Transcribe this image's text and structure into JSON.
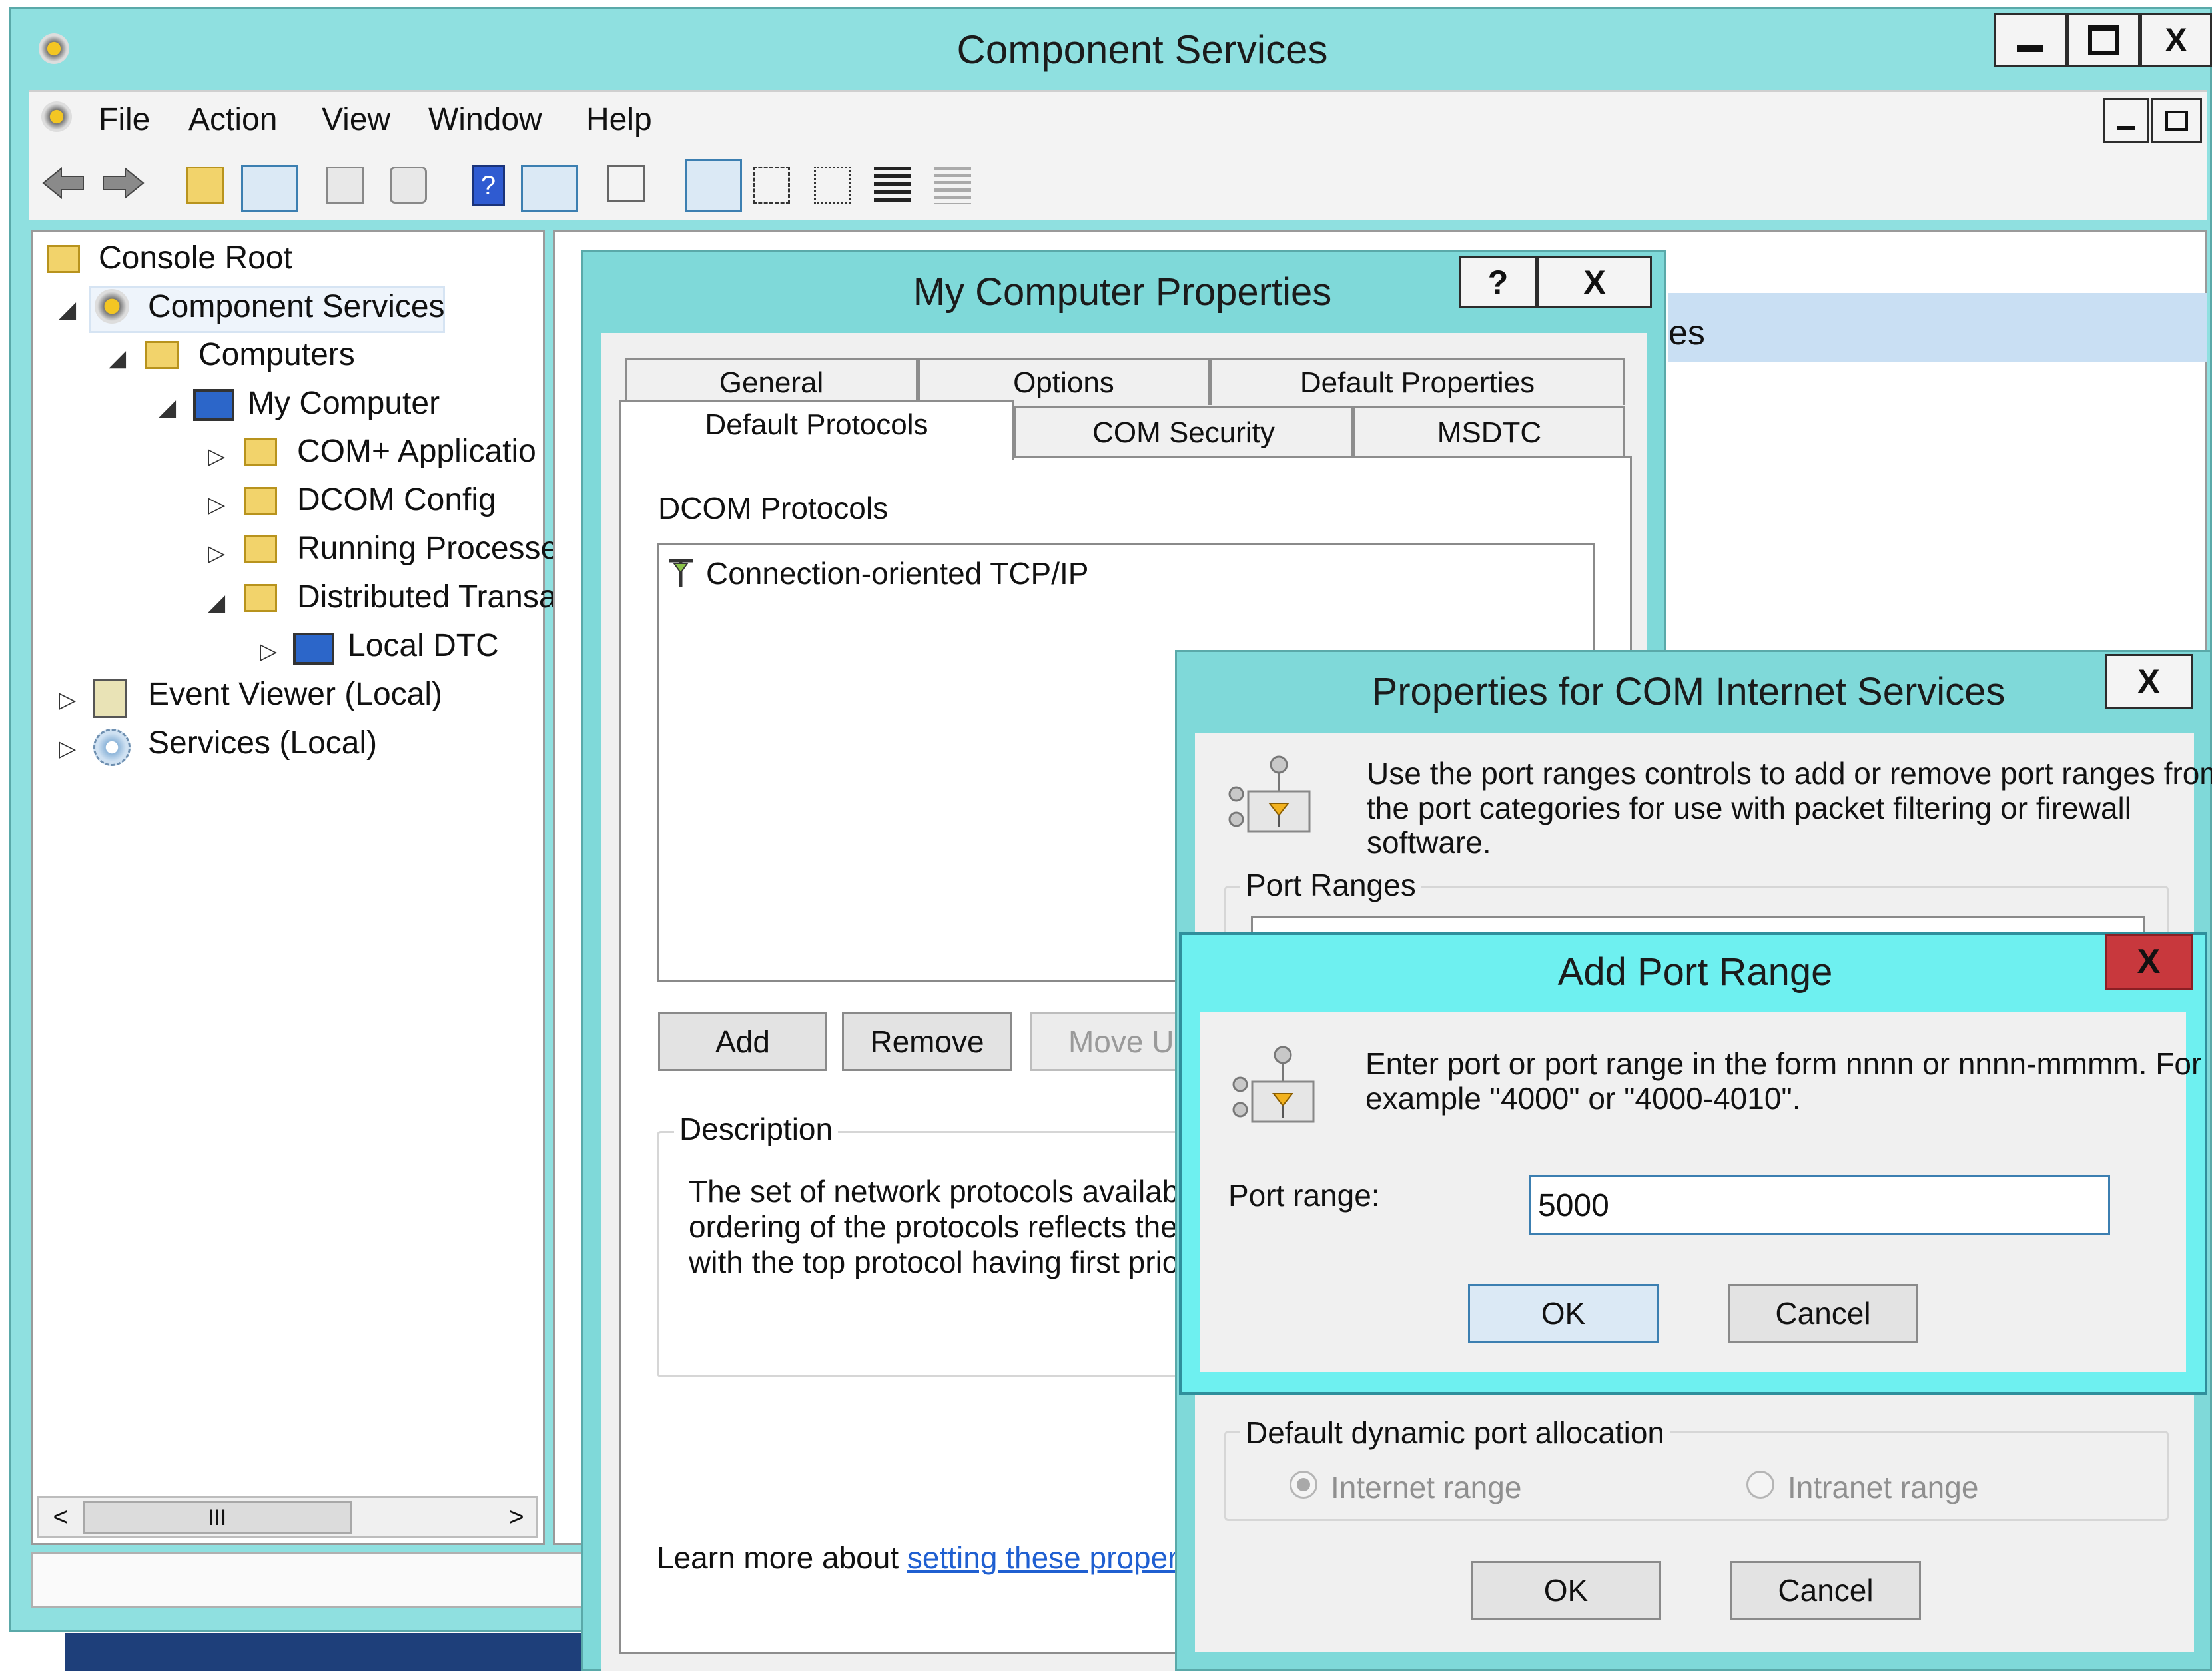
{
  "main_window": {
    "title": "Component Services",
    "menu": [
      "File",
      "Action",
      "View",
      "Window",
      "Help"
    ],
    "toolbar_icons": [
      "back-arrow-icon",
      "forward-arrow-icon",
      "up-folder-icon",
      "show-hide-tree-icon",
      "properties-icon",
      "refresh-icon",
      "help-icon",
      "action-pane-icon",
      "export-icon",
      "large-icons-icon",
      "small-icons-icon",
      "list-view-icon",
      "details-view-icon",
      "disabled-view-icon"
    ]
  },
  "tree": {
    "items": [
      {
        "label": "Console Root"
      },
      {
        "label": "Component Services"
      },
      {
        "label": "Computers"
      },
      {
        "label": "My Computer"
      },
      {
        "label": "COM+ Applicatio"
      },
      {
        "label": "DCOM Config"
      },
      {
        "label": "Running Processe"
      },
      {
        "label": "Distributed Transa"
      },
      {
        "label": "Local DTC"
      },
      {
        "label": "Event Viewer (Local)"
      },
      {
        "label": "Services (Local)"
      }
    ],
    "scroll_thumb": "III"
  },
  "right_pane": {
    "partial_text": "es"
  },
  "my_computer_props": {
    "title": "My Computer Properties",
    "help_btn": "?",
    "close_btn": "X",
    "tabs_row1": [
      "General",
      "Options",
      "Default Properties"
    ],
    "tabs_row2": [
      "Default Protocols",
      "COM Security",
      "MSDTC"
    ],
    "dcom_protocols_label": "DCOM Protocols",
    "protocols": [
      "Connection-oriented TCP/IP"
    ],
    "buttons": {
      "add": "Add",
      "remove": "Remove",
      "move_up": "Move Up"
    },
    "description_label": "Description",
    "description_lines": [
      "The set of network protocols available t",
      "ordering of the protocols reflects the pri",
      "with the top protocol having first priority"
    ],
    "learn_more_prefix": "Learn more about ",
    "learn_more_link": "setting these properties",
    "learn_more_suffix": "."
  },
  "com_internet_props": {
    "title": "Properties for COM Internet Services",
    "close_btn": "X",
    "intro_lines": [
      "Use the port ranges controls to add or remove port ranges from",
      "the port categories for use with packet filtering or firewall",
      "software."
    ],
    "port_ranges_label": "Port Ranges",
    "dynamic_label": "Default dynamic port allocation",
    "radio_internet": "Internet range",
    "radio_intranet": "Intranet range",
    "ok": "OK",
    "cancel": "Cancel"
  },
  "add_port_range": {
    "title": "Add Port Range",
    "close_btn": "X",
    "intro_lines": [
      "Enter port or port range in the form  nnnn or nnnn-mmmm. For",
      "example \"4000\" or \"4000-4010\"."
    ],
    "port_label": "Port range:",
    "port_value": "5000",
    "ok": "OK",
    "cancel": "Cancel"
  }
}
